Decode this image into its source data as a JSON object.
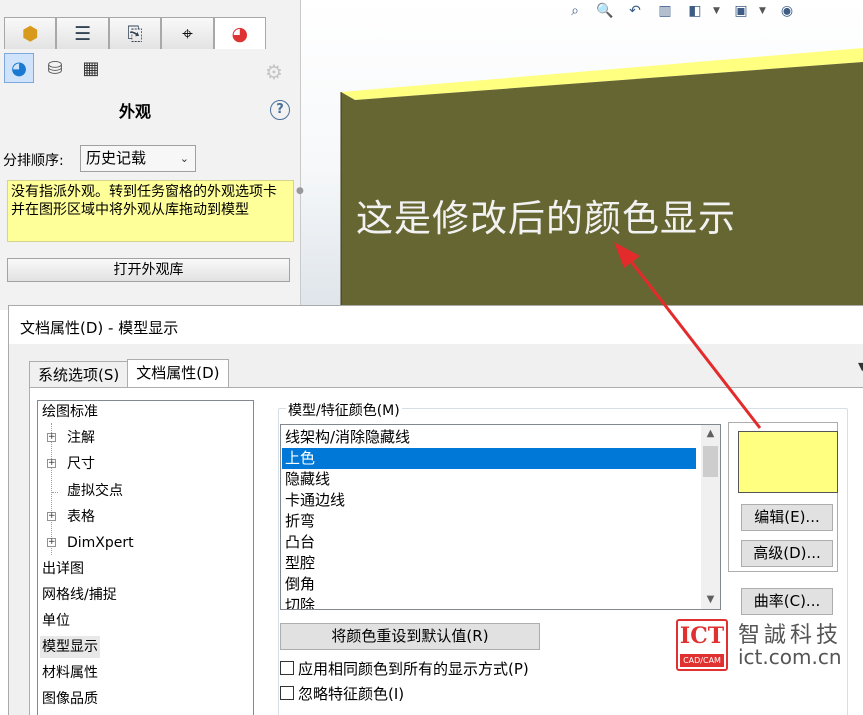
{
  "viewport": {
    "annotation": "这是修改后的颜色显示",
    "model_color": "#666633",
    "edge_color": "#ffff80",
    "toolbar_icons": [
      "zoom-to-fit-icon",
      "zoom-area-icon",
      "previous-view-icon",
      "section-view-icon",
      "view-orientation-icon",
      "display-style-icon",
      "appearance-icon"
    ]
  },
  "left_panel": {
    "tabs": [
      "feature-manager-icon",
      "property-manager-icon",
      "configuration-manager-icon",
      "dimxpert-manager-icon",
      "display-manager-icon"
    ],
    "subtabs": [
      "appearance-icon",
      "decal-icon",
      "scene-icon"
    ],
    "title": "外观",
    "help": "?",
    "sort_label": "分排顺序:",
    "sort_value": "历史记载",
    "info_text": "没有指派外观。转到任务窗格的外观选项卡并在图形区域中将外观从库拖动到模型",
    "open_library_button": "打开外观库"
  },
  "dialog": {
    "title": "文档属性(D) - 模型显示",
    "tabs": [
      "系统选项(S)",
      "文档属性(D)"
    ],
    "tree": [
      {
        "label": "绘图标准",
        "indent": 0,
        "expandable": false
      },
      {
        "label": "注解",
        "indent": 1,
        "expandable": true
      },
      {
        "label": "尺寸",
        "indent": 1,
        "expandable": true
      },
      {
        "label": "虚拟交点",
        "indent": 1,
        "expandable": false
      },
      {
        "label": "表格",
        "indent": 1,
        "expandable": true
      },
      {
        "label": "DimXpert",
        "indent": 1,
        "expandable": true
      },
      {
        "label": "出详图",
        "indent": 0,
        "expandable": false
      },
      {
        "label": "网格线/捕捉",
        "indent": 0,
        "expandable": false
      },
      {
        "label": "单位",
        "indent": 0,
        "expandable": false
      },
      {
        "label": "模型显示",
        "indent": 0,
        "expandable": false,
        "selected": true
      },
      {
        "label": "材料属性",
        "indent": 0,
        "expandable": false
      },
      {
        "label": "图像品质",
        "indent": 0,
        "expandable": false
      }
    ],
    "color_group_label": "模型/特征颜色(M)",
    "feature_items": [
      "线架构/消除隐藏线",
      "上色",
      "隐藏线",
      "卡通边线",
      "折弯",
      "凸台",
      "型腔",
      "倒角",
      "切除"
    ],
    "selected_index": 1,
    "swatch_color": "#ffff80",
    "edit_button": "编辑(E)...",
    "advanced_button": "高级(D)...",
    "curvature_button": "曲率(C)...",
    "reset_button": "将颜色重设到默认值(R)",
    "checkbox_apply_all": "应用相同颜色到所有的显示方式(P)",
    "checkbox_ignore": "忽略特征颜色(I)"
  },
  "watermark": {
    "logo_text": "ICT",
    "logo_sub": "CAD/CAM",
    "company": "智誠科技",
    "url": "ict.com.cn"
  }
}
